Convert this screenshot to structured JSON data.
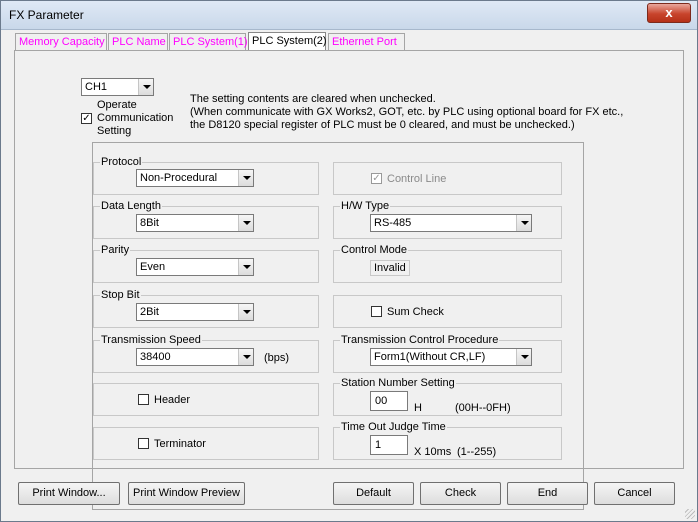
{
  "window": {
    "title": "FX Parameter",
    "close": "x"
  },
  "tabs": [
    {
      "label": "Memory Capacity",
      "active": false
    },
    {
      "label": "PLC Name",
      "active": false
    },
    {
      "label": "PLC System(1)",
      "active": false
    },
    {
      "label": "PLC System(2)",
      "active": true
    },
    {
      "label": "Ethernet Port",
      "active": false
    }
  ],
  "channel": {
    "value": "CH1"
  },
  "operate": {
    "checked": true,
    "line1": "Operate",
    "line2": "Communication",
    "line3": "Setting"
  },
  "note": {
    "line1": "The setting contents are cleared when unchecked.",
    "line2": "(When communicate with GX Works2, GOT, etc. by PLC using optional board for FX etc.,",
    "line3": " the D8120 special register of PLC must be 0 cleared, and must be unchecked.)"
  },
  "protocol": {
    "label": "Protocol",
    "value": "Non-Procedural"
  },
  "data_length": {
    "label": "Data Length",
    "value": "8Bit"
  },
  "parity": {
    "label": "Parity",
    "value": "Even"
  },
  "stop_bit": {
    "label": "Stop Bit",
    "value": "2Bit"
  },
  "speed": {
    "label": "Transmission Speed",
    "value": "38400",
    "unit": "(bps)"
  },
  "header": {
    "label": "Header",
    "checked": false
  },
  "terminator": {
    "label": "Terminator",
    "checked": false
  },
  "control_line": {
    "label": "Control Line",
    "checked": true,
    "enabled": false
  },
  "hw_type": {
    "label": "H/W Type",
    "value": "RS-485"
  },
  "control_mode": {
    "label": "Control Mode",
    "value": "Invalid"
  },
  "sum_check": {
    "label": "Sum Check",
    "checked": false
  },
  "tx_proc": {
    "label": "Transmission Control Procedure",
    "value": "Form1(Without CR,LF)"
  },
  "station": {
    "label": "Station Number Setting",
    "value": "00",
    "unit": "H",
    "range": "(00H--0FH)"
  },
  "timeout": {
    "label": "Time Out Judge Time",
    "value": "1",
    "unit": "X 10ms",
    "range": "(1--255)"
  },
  "buttons": {
    "print_window": "Print Window...",
    "print_preview": "Print Window Preview",
    "default": "Default",
    "check": "Check",
    "end": "End",
    "cancel": "Cancel"
  },
  "check_mark": "✓"
}
